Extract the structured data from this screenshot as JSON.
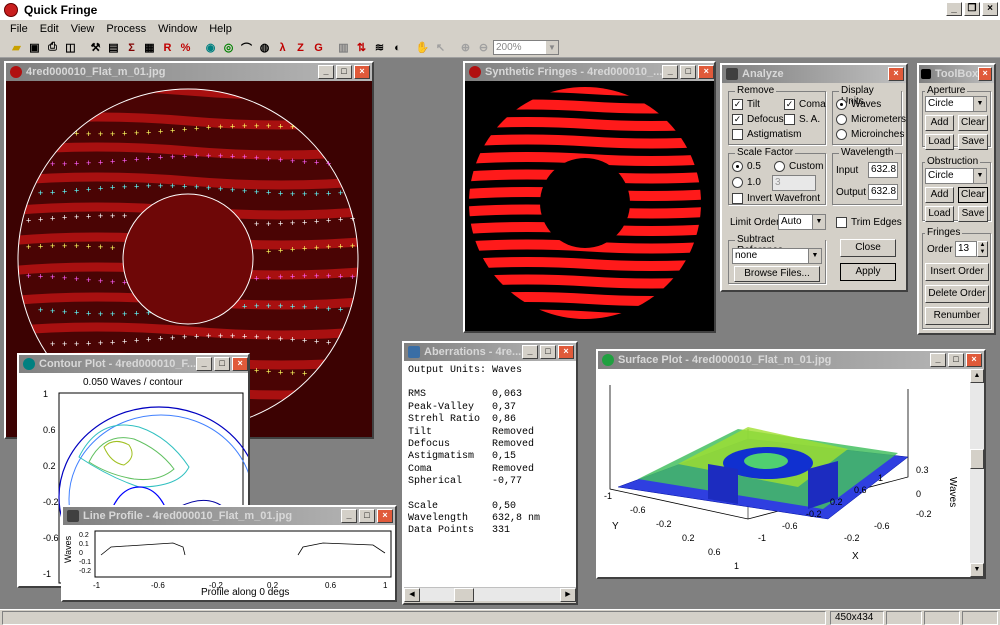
{
  "app": {
    "title": "Quick Fringe"
  },
  "menu": [
    "File",
    "Edit",
    "View",
    "Process",
    "Window",
    "Help"
  ],
  "toolbar": {
    "zoom": "200%"
  },
  "status": {
    "size": "450x434"
  },
  "colors": {
    "fringe": "#c01010",
    "plot_bg": "#2a0000",
    "accent": "#0000ff"
  },
  "windows": {
    "fringe": {
      "title": "4red000010_Flat_m_01.jpg"
    },
    "synthetic": {
      "title": "Synthetic Fringes - 4red000010_..."
    },
    "analyze": {
      "title": "Analyze",
      "remove": {
        "label": "Remove",
        "tilt": "Tilt",
        "coma": "Coma",
        "defocus": "Defocus",
        "sa": "S. A.",
        "astig": "Astigmatism"
      },
      "units": {
        "label": "Display Units",
        "waves": "Waves",
        "micrometers": "Micrometers",
        "microinches": "Microinches"
      },
      "scale": {
        "label": "Scale Factor",
        "v05": "0.5",
        "custom": "Custom",
        "v10": "1.0",
        "custom_value": "3"
      },
      "invert": "Invert Wavefront",
      "wavelength": {
        "label": "Wavelength",
        "input_label": "Input",
        "input": "632.8",
        "output_label": "Output",
        "output": "632.8"
      },
      "limit": {
        "label": "Limit Order",
        "value": "Auto"
      },
      "trim": "Trim Edges",
      "subtract": {
        "label": "Subtract Reference",
        "value": "none",
        "browse": "Browse Files..."
      },
      "close": "Close",
      "apply": "Apply"
    },
    "toolbox": {
      "title": "ToolBox",
      "aperture": {
        "label": "Aperture",
        "value": "Circle",
        "add": "Add",
        "clear": "Clear",
        "load": "Load",
        "save": "Save"
      },
      "obstruction": {
        "label": "Obstruction",
        "value": "Circle",
        "add": "Add",
        "clear": "Clear",
        "load": "Load",
        "save": "Save"
      },
      "fringes": {
        "label": "Fringes",
        "order_label": "Order",
        "order": "13",
        "insert": "Insert Order",
        "delete": "Delete Order",
        "renumber": "Renumber"
      }
    },
    "contour": {
      "title": "Contour Plot - 4red000010_F...",
      "subtitle": "0.050 Waves / contour",
      "yticks": [
        "1",
        "0.6",
        "0.2",
        "-0.2",
        "-0.6",
        "-1"
      ]
    },
    "aberr": {
      "title": "Aberrations - 4re...",
      "units": "Output Units: Waves",
      "rows": [
        {
          "k": "RMS",
          "v": "0,063"
        },
        {
          "k": "Peak-Valley",
          "v": "0,37"
        },
        {
          "k": "Strehl Ratio",
          "v": "0,86"
        },
        {
          "k": "Tilt",
          "v": "Removed"
        },
        {
          "k": "Defocus",
          "v": "Removed"
        },
        {
          "k": "Astigmatism",
          "v": "0,15"
        },
        {
          "k": "Coma",
          "v": "Removed"
        },
        {
          "k": "Spherical",
          "v": "-0,77"
        }
      ],
      "rows2": [
        {
          "k": "Scale",
          "v": "0,50"
        },
        {
          "k": "Wavelength",
          "v": "632,8 nm"
        },
        {
          "k": "Data Points",
          "v": "331"
        }
      ]
    },
    "line": {
      "title": "Line Profile - 4red000010_Flat_m_01.jpg",
      "xlabel": "Profile along 0 degs",
      "ylabel": "Waves",
      "yticks": [
        "0.2",
        "0.1",
        "0",
        "-0.1",
        "-0.2"
      ],
      "xticks": [
        "-1",
        "-0.6",
        "-0.2",
        "0.2",
        "0.6",
        "1"
      ]
    },
    "surface": {
      "title": "Surface Plot - 4red000010_Flat_m_01.jpg",
      "ylabel": "Waves",
      "y_axis": "Y",
      "x_axis": "X",
      "zticks": [
        "0.3",
        "0",
        "-0.2"
      ],
      "yticks": [
        "-1",
        "-0.6",
        "-0.2",
        "0.2",
        "0.6",
        "1"
      ],
      "xticks": [
        "-1",
        "-0.6",
        "-0.2",
        "0.2",
        "0.6",
        "1"
      ],
      "xticks_right": [
        "-0.2",
        "-0.6"
      ]
    }
  }
}
